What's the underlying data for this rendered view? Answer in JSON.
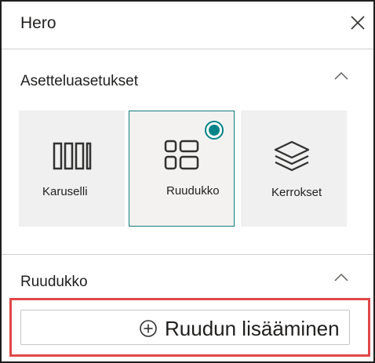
{
  "panel": {
    "title": "Hero",
    "close_icon": "close-icon"
  },
  "layout_section": {
    "title": "Asetteluasetukset",
    "collapse_icon": "chevron-up-icon",
    "options": [
      {
        "label": "Karuselli",
        "icon": "carousel-icon",
        "selected": false
      },
      {
        "label": "Ruudukko",
        "icon": "grid-icon",
        "selected": true
      },
      {
        "label": "Kerrokset",
        "icon": "layers-icon",
        "selected": false
      }
    ]
  },
  "grid_section": {
    "title": "Ruudukko",
    "collapse_icon": "chevron-up-icon",
    "add_button_label": "Ruudun lisääminen",
    "add_icon": "add-circle-icon"
  },
  "colors": {
    "accent": "#038387",
    "highlight": "#e04848",
    "tile_background": "#f0f0f0"
  }
}
